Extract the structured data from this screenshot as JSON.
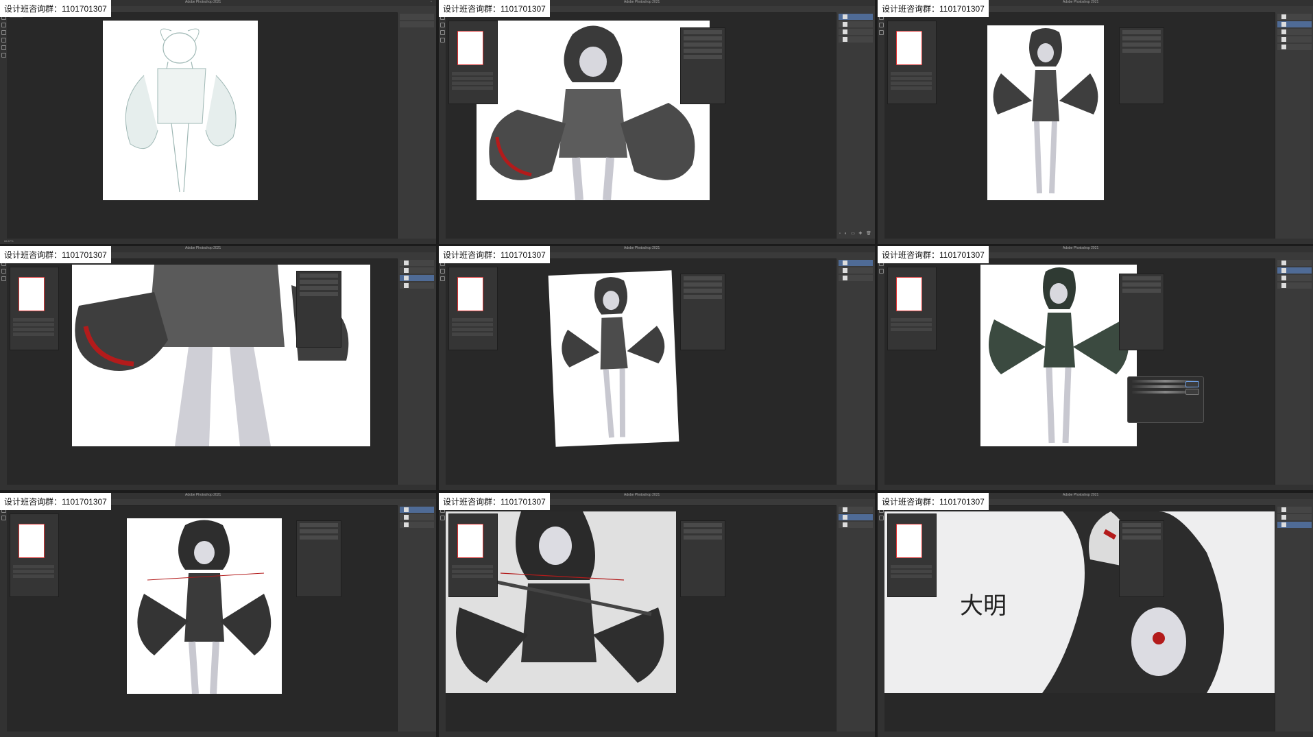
{
  "label": "设计班咨询群：1101701307",
  "app_title": "Adobe Photoshop 2021",
  "signature": "大明",
  "tiles": [
    {
      "id": 1,
      "canvas": "white",
      "variant": "sketch"
    },
    {
      "id": 2,
      "canvas": "white",
      "variant": "flat-gray"
    },
    {
      "id": 3,
      "canvas": "white",
      "variant": "full-figure"
    },
    {
      "id": 4,
      "canvas": "white",
      "variant": "zoom-legs"
    },
    {
      "id": 5,
      "canvas": "white",
      "variant": "tilted"
    },
    {
      "id": 6,
      "canvas": "white",
      "variant": "dialog"
    },
    {
      "id": 7,
      "canvas": "white",
      "variant": "color"
    },
    {
      "id": 8,
      "canvas": "gray",
      "variant": "detail"
    },
    {
      "id": 9,
      "canvas": "light",
      "variant": "closeup"
    }
  ],
  "colors": {
    "accent_red": "#b31b1b",
    "ui_dark": "#282828",
    "panel": "#3a3a3a"
  }
}
